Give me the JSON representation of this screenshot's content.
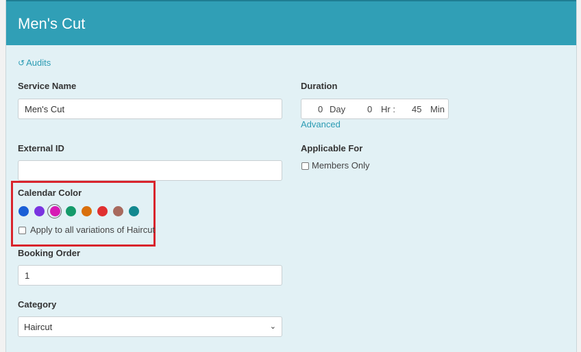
{
  "modal": {
    "title": "Men's Cut",
    "audits_link": "Audits",
    "icons": {
      "audits": "history-icon",
      "select": "chevron-down-icon"
    }
  },
  "service_name": {
    "label": "Service Name",
    "value": "Men's Cut"
  },
  "duration": {
    "label": "Duration",
    "day_value": "0",
    "day_unit": "Day",
    "hr_value": "0",
    "hr_unit": "Hr :",
    "min_value": "45",
    "min_unit": "Min",
    "advanced_link": "Advanced"
  },
  "external_id": {
    "label": "External ID",
    "value": ""
  },
  "applicable_for": {
    "label": "Applicable For",
    "members_only_label": "Members Only",
    "members_only_checked": false
  },
  "calendar_color": {
    "label": "Calendar Color",
    "colors": [
      "#1a5fd6",
      "#7a34e0",
      "#d61bb4",
      "#149a6a",
      "#d9700c",
      "#e03030",
      "#a86a5e",
      "#12888f"
    ],
    "selected_index": 2,
    "apply_all_label": "Apply to all variations of Haircut",
    "apply_all_checked": false
  },
  "booking_order": {
    "label": "Booking Order",
    "value": "1"
  },
  "category": {
    "label": "Category",
    "value": "Haircut"
  }
}
